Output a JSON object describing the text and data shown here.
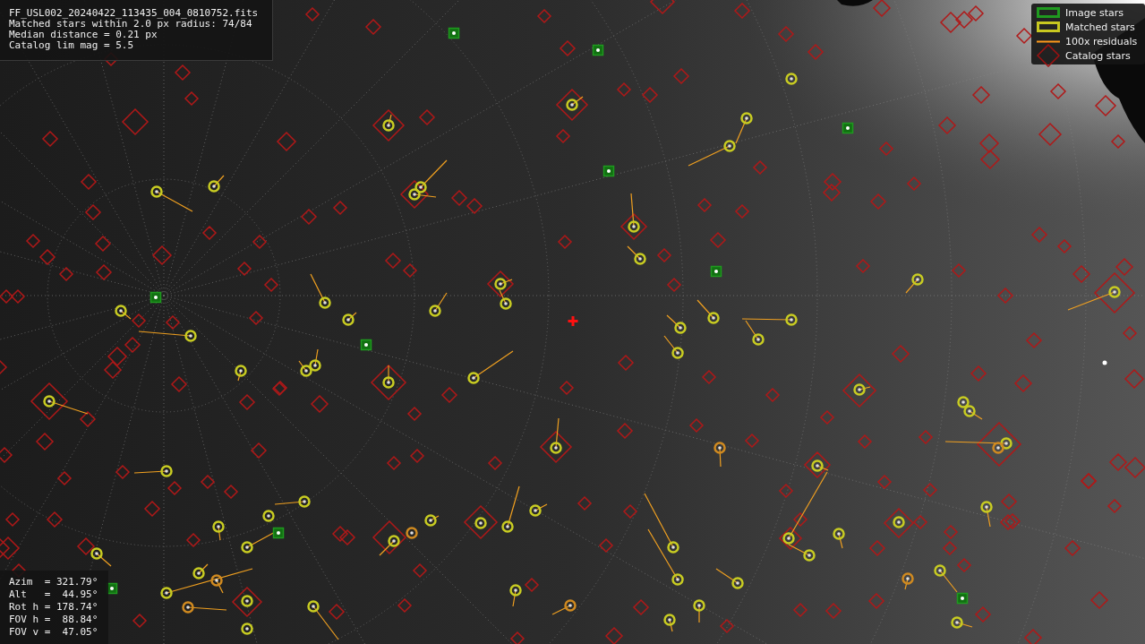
{
  "file_info": {
    "lines": [
      "FF_USL002_20240422_113435_004_0810752.fits",
      "Matched stars within 2.0 px radius: 74/84",
      "Median distance = 0.21 px",
      "Catalog lim mag = 5.5"
    ]
  },
  "legend": {
    "items": [
      {
        "kind": "image",
        "label": "Image stars"
      },
      {
        "kind": "matched",
        "label": "Matched stars"
      },
      {
        "kind": "residual",
        "label": "100x residuals"
      },
      {
        "kind": "catalog",
        "label": "Catalog stars"
      }
    ]
  },
  "pointing": {
    "lines": [
      "Azim  = 321.79°",
      "Alt   =  44.95°",
      "Rot h = 178.74°",
      "FOV h =  88.84°",
      "FOV v =  47.05°"
    ]
  }
}
